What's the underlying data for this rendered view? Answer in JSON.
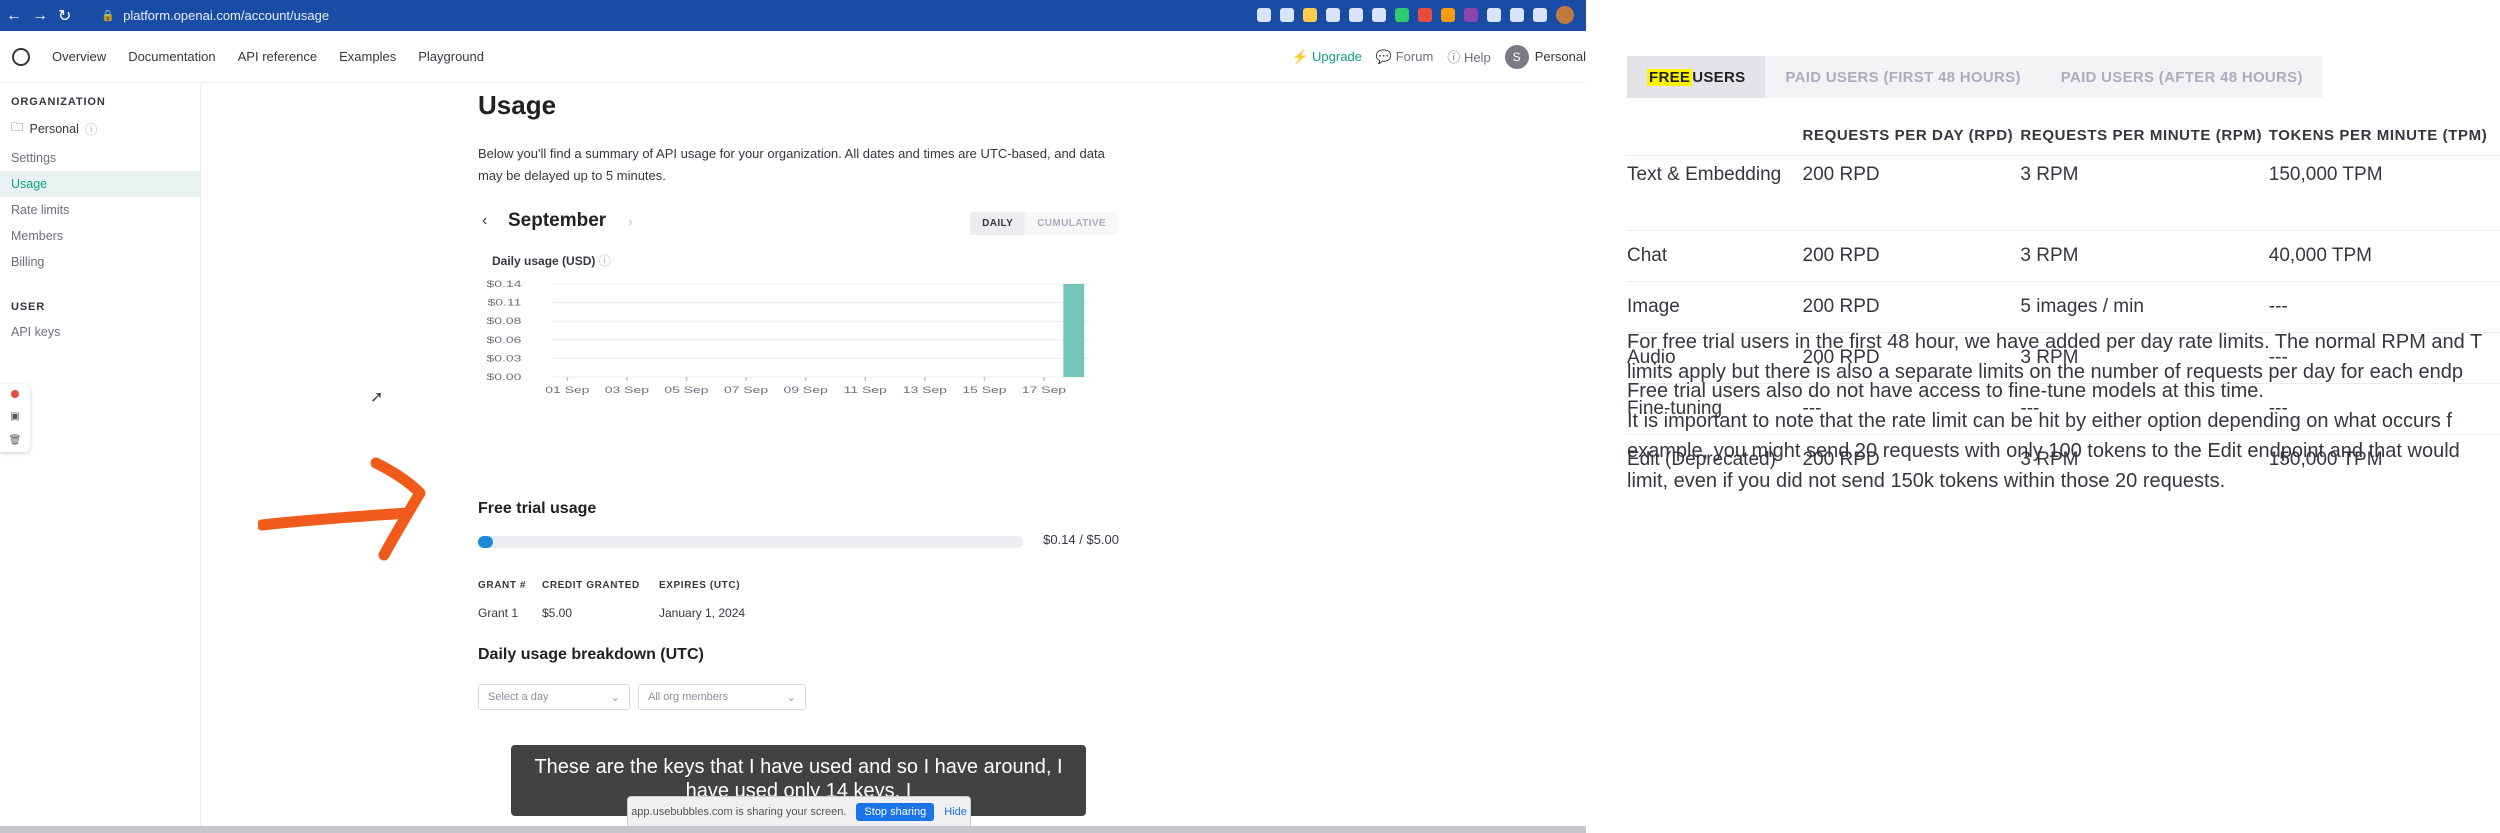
{
  "browser": {
    "url": "platform.openai.com/account/usage",
    "nav": {
      "back": "←",
      "forward": "→",
      "reload": "↻"
    }
  },
  "topnav": {
    "links": [
      "Overview",
      "Documentation",
      "API reference",
      "Examples",
      "Playground"
    ],
    "upgrade": "Upgrade",
    "forum": "Forum",
    "help": "Help",
    "avatar_initial": "S",
    "account": "Personal"
  },
  "sidebar": {
    "org_header": "ORGANIZATION",
    "org_name": "Personal",
    "org_items": [
      "Settings",
      "Usage",
      "Rate limits",
      "Members",
      "Billing"
    ],
    "active_item": "Usage",
    "user_header": "USER",
    "user_items": [
      "API keys"
    ]
  },
  "usage": {
    "title": "Usage",
    "description": "Below you'll find a summary of API usage for your organization. All dates and times are UTC-based, and data may be delayed up to 5 minutes.",
    "month": "September",
    "toggle": {
      "daily": "DAILY",
      "cumulative": "CUMULATIVE"
    },
    "chart_label": "Daily usage (USD)",
    "free_trial_title": "Free trial usage",
    "free_trial_amount": "$0.14 / $5.00",
    "free_trial_fraction": 0.028,
    "grants_headers": [
      "GRANT #",
      "CREDIT GRANTED",
      "EXPIRES (UTC)"
    ],
    "grants_rows": [
      [
        "Grant 1",
        "$5.00",
        "January 1, 2024"
      ]
    ],
    "breakdown_title": "Daily usage breakdown (UTC)",
    "select_day": "Select a day",
    "select_members": "All org members"
  },
  "chart_data": {
    "type": "bar",
    "title": "Daily usage (USD)",
    "x_tick_labels": [
      "01 Sep",
      "03 Sep",
      "05 Sep",
      "07 Sep",
      "09 Sep",
      "11 Sep",
      "13 Sep",
      "15 Sep",
      "17 Sep"
    ],
    "y_tick_labels": [
      "$0.14",
      "$0.11",
      "$0.08",
      "$0.06",
      "$0.03",
      "$0.00"
    ],
    "categories": [
      "01 Sep",
      "02 Sep",
      "03 Sep",
      "04 Sep",
      "05 Sep",
      "06 Sep",
      "07 Sep",
      "08 Sep",
      "09 Sep",
      "10 Sep",
      "11 Sep",
      "12 Sep",
      "13 Sep",
      "14 Sep",
      "15 Sep",
      "16 Sep",
      "17 Sep",
      "18 Sep"
    ],
    "values": [
      0,
      0,
      0,
      0,
      0,
      0,
      0,
      0,
      0,
      0,
      0,
      0,
      0,
      0,
      0,
      0,
      0,
      0.14
    ],
    "ylim": [
      0,
      0.14
    ],
    "bar_color": "#74c7b8",
    "grid": true
  },
  "caption": "These are the keys that I have used and so I have around, I have used only 14 keys, I",
  "sharebar": {
    "text": "app.usebubbles.com is sharing your screen.",
    "stop": "Stop sharing",
    "hide": "Hide"
  },
  "doc": {
    "tabs": [
      {
        "label_hl": "FREE",
        "label_rest": " USERS",
        "active": true
      },
      {
        "label": "PAID USERS (FIRST 48 HOURS)"
      },
      {
        "label": "PAID USERS (AFTER 48 HOURS)"
      }
    ],
    "table_headers": [
      "",
      "REQUESTS PER DAY (RPD)",
      "REQUESTS PER MINUTE (RPM)",
      "TOKENS PER MINUTE (TPM)"
    ],
    "table_rows": [
      [
        "Text & Embedding",
        "200 RPD",
        "3 RPM",
        "150,000 TPM"
      ],
      [
        "Chat",
        "200 RPD",
        "3 RPM",
        "40,000 TPM"
      ],
      [
        "Image",
        "200 RPD",
        "5 images / min",
        "---"
      ],
      [
        "Audio",
        "200 RPD",
        "3 RPM",
        "---"
      ],
      [
        "Fine-tuning",
        "---",
        "---",
        "---"
      ],
      [
        "Edit (Deprecated)",
        "200 RPD",
        "3 RPM",
        "150,000 TPM"
      ]
    ],
    "para1_line1": "For free trial users in the first 48 hour, we have added per day rate limits. The normal RPM and T",
    "para1_line2": "limits apply but there is also a separate limits on the number of requests per day for each endp",
    "para2": "Free trial users also do not have access to fine-tune models at this time.",
    "para3_line1": "It is important to note that the rate limit can be hit by either option depending on what occurs f",
    "para3_line2": "example, you might send 20 requests with only 100 tokens to the Edit endpoint and that would",
    "para3_line3": "limit, even if you did not send 150k tokens within those 20 requests."
  },
  "colors": {
    "chrome_blue": "#1a4ca5",
    "accent_green": "#10a37f",
    "progress_blue": "#1d8bd8",
    "arrow_orange": "#f05a1a",
    "highlight_yellow": "#fff200"
  }
}
